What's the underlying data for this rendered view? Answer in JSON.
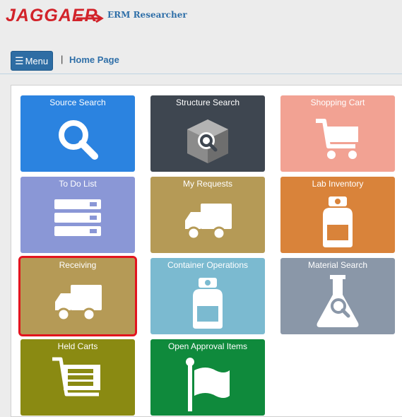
{
  "header": {
    "logo_text": "JAGGAER",
    "app_title": "ERM Researcher"
  },
  "navbar": {
    "menu_label": "Menu",
    "separator": "|",
    "breadcrumb": "Home Page"
  },
  "tiles": [
    {
      "label": "Source Search",
      "icon": "search-icon",
      "color": "#2b83e0"
    },
    {
      "label": "Structure Search",
      "icon": "structure-box-search-icon",
      "color": "#3e4650"
    },
    {
      "label": "Shopping Cart",
      "icon": "shopping-cart-icon",
      "color": "#f2a293"
    },
    {
      "label": "To Do List",
      "icon": "list-icon",
      "color": "#8a97d6"
    },
    {
      "label": "My Requests",
      "icon": "truck-icon",
      "color": "#b59a56"
    },
    {
      "label": "Lab Inventory",
      "icon": "bottle-icon",
      "color": "#d9833a"
    },
    {
      "label": "Receiving",
      "icon": "truck-icon",
      "color": "#b59a56",
      "selected": true
    },
    {
      "label": "Container Operations",
      "icon": "bottle-icon",
      "color": "#7bbad0"
    },
    {
      "label": "Material Search",
      "icon": "flask-search-icon",
      "color": "#8a97a8"
    },
    {
      "label": "Held Carts",
      "icon": "cart-list-icon",
      "color": "#8a8a12"
    },
    {
      "label": "Open Approval Items",
      "icon": "flag-icon",
      "color": "#0f8a3c"
    }
  ]
}
